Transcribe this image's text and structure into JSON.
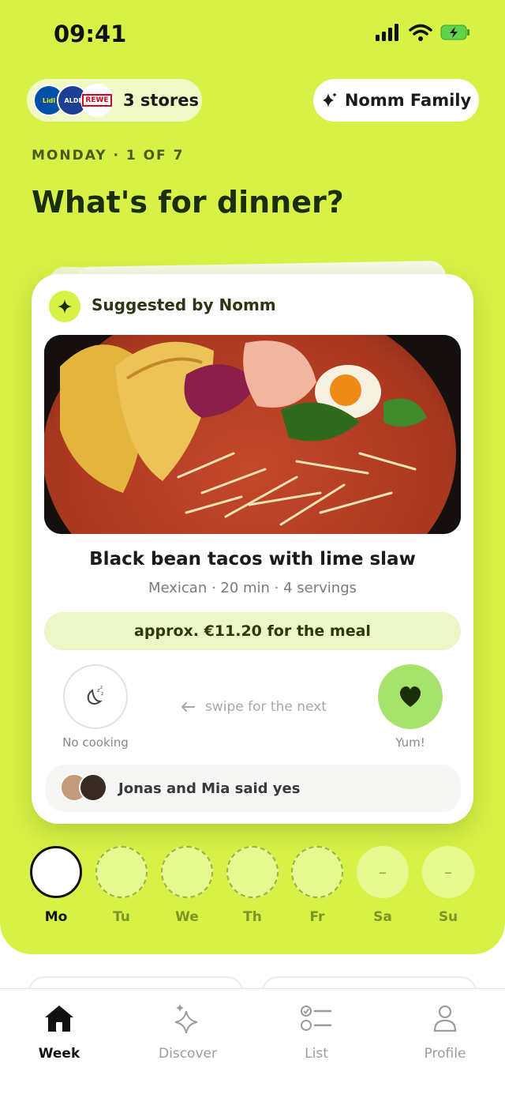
{
  "status_bar": {
    "time": "09:41"
  },
  "header": {
    "stores_label": "3 stores",
    "store_logos": [
      "Lidl",
      "ALDI",
      "REWE"
    ],
    "family_label": "Nomm Family",
    "day_label": "MONDAY · 1 OF 7",
    "title": "What's for dinner?"
  },
  "card": {
    "suggested_by": "Suggested by Nomm",
    "meal_title": "Black bean tacos with lime slaw",
    "meal_meta": "Mexican · 20 min · 4 servings",
    "price": "approx. €11.20 for the meal",
    "no_cooking_label": "No cooking",
    "swipe_hint": "swipe for the next",
    "yum_label": "Yum!",
    "voters_text": "Jonas and Mia said yes"
  },
  "week": {
    "days": [
      {
        "label": "Mo",
        "state": "selected",
        "mark": ""
      },
      {
        "label": "Tu",
        "state": "dashed",
        "mark": ""
      },
      {
        "label": "We",
        "state": "dashed",
        "mark": ""
      },
      {
        "label": "Th",
        "state": "dashed",
        "mark": ""
      },
      {
        "label": "Fr",
        "state": "dashed",
        "mark": ""
      },
      {
        "label": "Sa",
        "state": "empty",
        "mark": "–"
      },
      {
        "label": "Su",
        "state": "empty",
        "mark": "–"
      }
    ]
  },
  "tabs": [
    {
      "label": "Week",
      "icon": "home-icon",
      "active": true
    },
    {
      "label": "Discover",
      "icon": "sparkle-icon",
      "active": false
    },
    {
      "label": "List",
      "icon": "checklist-icon",
      "active": false
    },
    {
      "label": "Profile",
      "icon": "person-icon",
      "active": false
    }
  ],
  "colors": {
    "accent": "#d8f146",
    "yum": "#a6e36c",
    "price_bg": "#ebf7c6"
  }
}
